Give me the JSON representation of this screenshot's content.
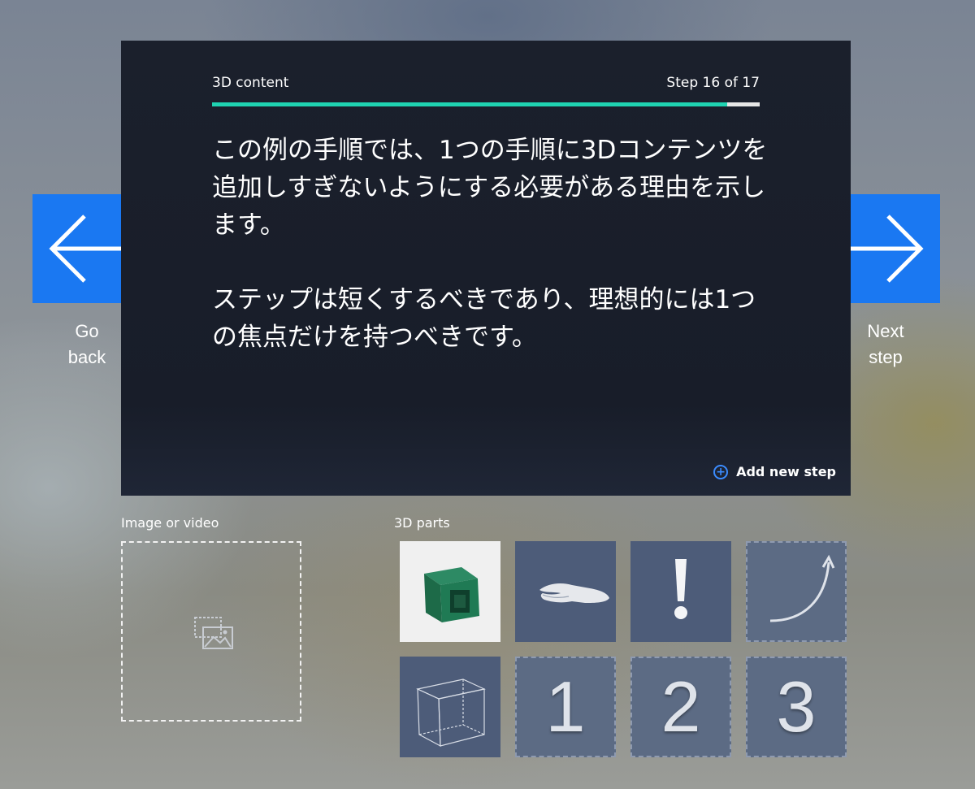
{
  "panel": {
    "category": "3D content",
    "step_indicator": "Step 16 of 17",
    "progress": 0.94,
    "body_text": "この例の手順では、1つの手順に3Dコンテンツを追加しすぎないようにする必要がある理由を示します。\n\nステップは短くするべきであり、理想的には1つの焦点だけを持つべきです。",
    "add_step_label": "Add new step",
    "colors": {
      "progress_fill": "#1fd3b2",
      "accent": "#3b8cff"
    }
  },
  "nav": {
    "back_label_line1": "Go",
    "back_label_line2": "back",
    "next_label_line1": "Next",
    "next_label_line2": "step",
    "button_color": "#1a78f2"
  },
  "media": {
    "section_label": "Image or video",
    "icon": "image-placeholder-icon"
  },
  "parts": {
    "section_label": "3D parts",
    "items": [
      {
        "icon": "green-box-model-icon"
      },
      {
        "icon": "hand-icon"
      },
      {
        "icon": "exclamation-icon"
      },
      {
        "icon": "curved-arrow-icon"
      },
      {
        "icon": "wireframe-cube-icon"
      },
      {
        "label": "1"
      },
      {
        "label": "2"
      },
      {
        "label": "3"
      }
    ]
  }
}
